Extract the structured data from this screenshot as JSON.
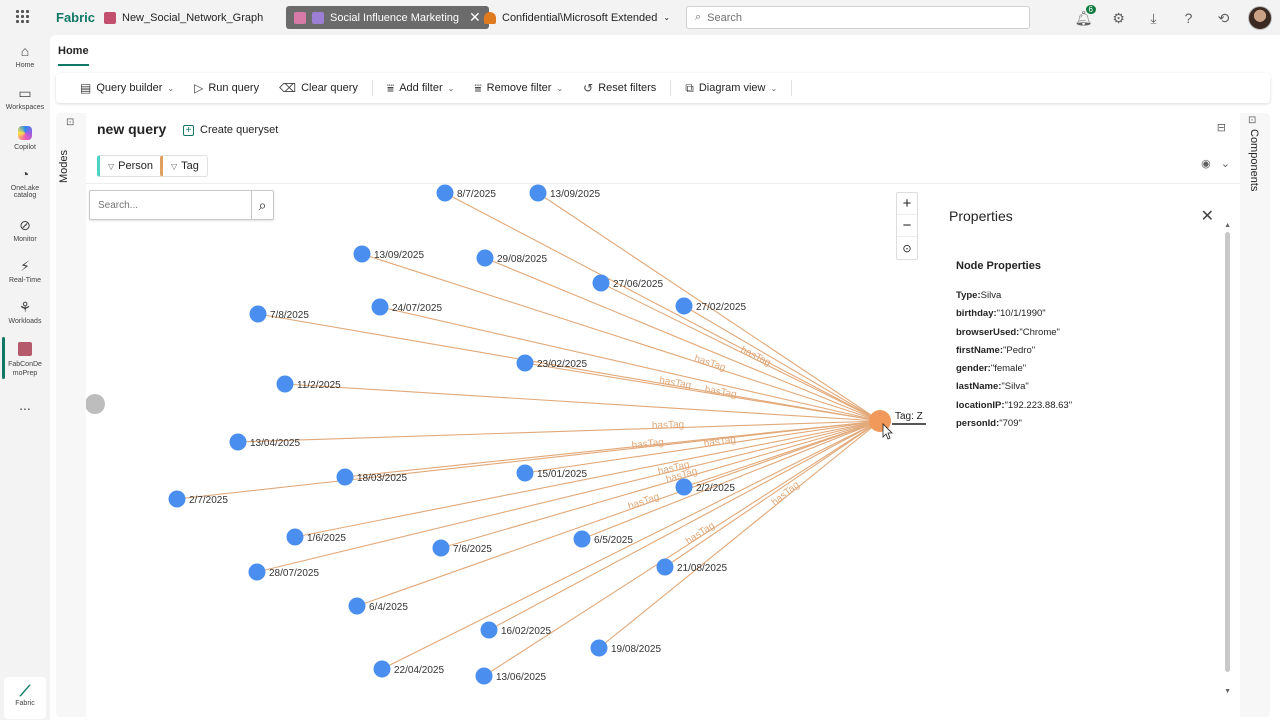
{
  "topbar": {
    "brand": "Fabric",
    "tabs": [
      {
        "label": "New_Social_Network_Graph",
        "active": false
      },
      {
        "label": "Social Influence Marketing",
        "active": true
      },
      {
        "label": "Confidential\\Microsoft Extended",
        "active": false
      }
    ],
    "search_placeholder": "Search",
    "notifications_count": "6"
  },
  "rail": {
    "items": [
      {
        "label": "Home",
        "icon": "home-icon"
      },
      {
        "label": "Workspaces",
        "icon": "workspaces-icon"
      },
      {
        "label": "Copilot",
        "icon": "copilot-icon"
      },
      {
        "label": "OneLake catalog",
        "icon": "onelake-icon"
      },
      {
        "label": "Monitor",
        "icon": "monitor-icon"
      },
      {
        "label": "Real-Time",
        "icon": "realtime-icon"
      },
      {
        "label": "Workloads",
        "icon": "workloads-icon"
      },
      {
        "label": "FabConDemoPrep",
        "icon": "workspace-icon"
      }
    ],
    "more": "...",
    "bottom_label": "Fabric"
  },
  "main": {
    "home_tab": "Home",
    "ribbon": {
      "query_builder": "Query builder",
      "run_query": "Run query",
      "clear_query": "Clear query",
      "add_filter": "Add filter",
      "remove_filter": "Remove filter",
      "reset_filters": "Reset filters",
      "diagram_view": "Diagram view"
    },
    "modes_label": "Modes",
    "components_label": "Components",
    "query_title": "new query",
    "create_queryset": "Create queryset",
    "chips": {
      "person": "Person",
      "tag": "Tag"
    },
    "graph_search_placeholder": "Search...",
    "tag_node_label": "Tag: Z",
    "edge_label": "hasTag",
    "person_nodes": [
      {
        "label": "8/7/2025"
      },
      {
        "label": "13/09/2025"
      },
      {
        "label": "13/09/2025"
      },
      {
        "label": "29/08/2025"
      },
      {
        "label": "27/06/2025"
      },
      {
        "label": "27/02/2025"
      },
      {
        "label": "7/8/2025"
      },
      {
        "label": "24/07/2025"
      },
      {
        "label": "23/02/2025"
      },
      {
        "label": "11/2/2025"
      },
      {
        "label": "13/04/2025"
      },
      {
        "label": "18/03/2025"
      },
      {
        "label": "15/01/2025"
      },
      {
        "label": "2/2/2025"
      },
      {
        "label": "2/7/2025"
      },
      {
        "label": "1/6/2025"
      },
      {
        "label": "7/6/2025"
      },
      {
        "label": "6/5/2025"
      },
      {
        "label": "28/07/2025"
      },
      {
        "label": "21/08/2025"
      },
      {
        "label": "6/4/2025"
      },
      {
        "label": "16/02/2025"
      },
      {
        "label": "19/08/2025"
      },
      {
        "label": "22/04/2025"
      },
      {
        "label": "13/06/2025"
      }
    ],
    "properties": {
      "title": "Properties",
      "section": "Node Properties",
      "items": [
        {
          "key": "Type:",
          "value": "Silva"
        },
        {
          "key": "birthday:",
          "value": "\"10/1/1990\""
        },
        {
          "key": "browserUsed:",
          "value": "\"Chrome\""
        },
        {
          "key": "firstName:",
          "value": "\"Pedro\""
        },
        {
          "key": "gender:",
          "value": "\"female\""
        },
        {
          "key": "lastName:",
          "value": "\"Silva\""
        },
        {
          "key": "locationIP:",
          "value": "\"192.223.88.63\""
        },
        {
          "key": "personId:",
          "value": "\"709\""
        }
      ]
    }
  },
  "colors": {
    "person_node": "#4a8ff0",
    "tag_node": "#f0995a",
    "edge": "#e2a878",
    "brand": "#117865"
  }
}
